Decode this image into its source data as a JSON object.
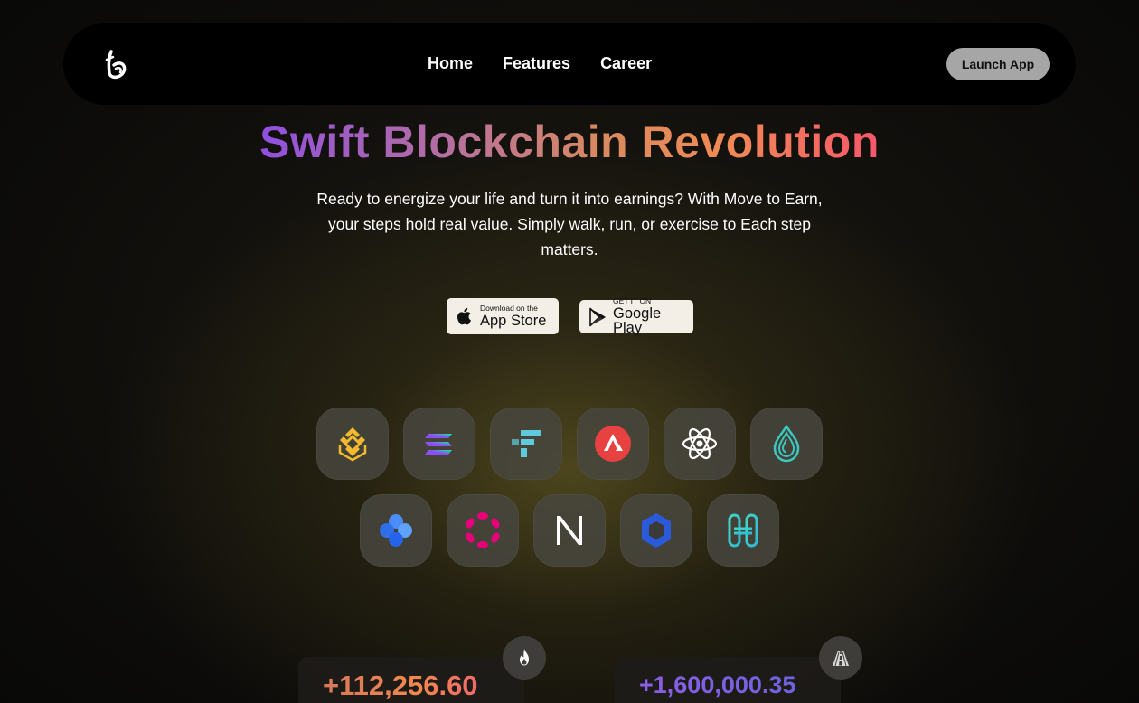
{
  "nav": {
    "logo_icon": "b-logo-icon",
    "links": [
      {
        "label": "Home"
      },
      {
        "label": "Features"
      },
      {
        "label": "Career"
      }
    ],
    "launch_label": "Launch App"
  },
  "hero": {
    "title": "Swift Blockchain Revolution",
    "subtitle": "Ready to energize your life and turn it into earnings? With Move to Earn, your steps hold real value. Simply walk, run, or exercise to Each step matters."
  },
  "stores": {
    "apple": {
      "small": "Download on the",
      "big": "App Store",
      "icon": "apple-icon"
    },
    "google": {
      "small": "GET IT ON",
      "big": "Google Play",
      "icon": "google-play-icon"
    }
  },
  "tokens": [
    {
      "name": "bnb-icon",
      "color": "#F3BA2F"
    },
    {
      "name": "solana-icon",
      "color": "#9945FF"
    },
    {
      "name": "ftx-icon",
      "color": "#5FCADE"
    },
    {
      "name": "avalanche-icon",
      "color": "#E84142"
    },
    {
      "name": "cosmos-icon",
      "color": "#FFFFFF"
    },
    {
      "name": "sei-drop-icon",
      "color": "#3CC7C0"
    },
    {
      "name": "ocean-icon",
      "color": "#3B82F6"
    },
    {
      "name": "polkadot-icon",
      "color": "#E6007A"
    },
    {
      "name": "near-icon",
      "color": "#FFFFFF"
    },
    {
      "name": "chainlink-icon",
      "color": "#2A5ADA"
    },
    {
      "name": "harmony-icon",
      "color": "#3FD8C9"
    }
  ],
  "stats": [
    {
      "value": "+112,256.60",
      "icon": "fire-icon"
    },
    {
      "value": "+1,600,000.35",
      "icon": "road-icon"
    }
  ]
}
